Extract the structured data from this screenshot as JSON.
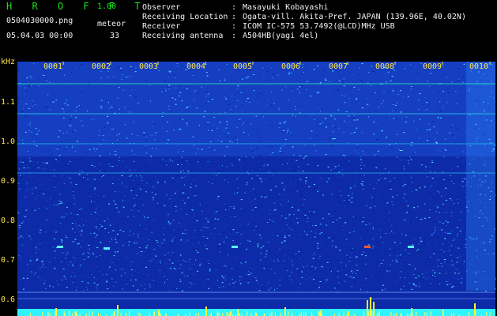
{
  "app": {
    "title_letters": "H R O F F T",
    "version": "1.00",
    "file_name": "0504030000.png",
    "datetime": "05.04.03 00:00",
    "meteor_label": "meteor",
    "meteor_count": "33"
  },
  "info": [
    {
      "label": "Observer",
      "sep": ":",
      "value": "Masayuki Kobayashi"
    },
    {
      "label": "Receiving Location",
      "sep": ":",
      "value": "Ogata-vill. Akita-Pref. JAPAN (139.96E, 40.02N)"
    },
    {
      "label": "Receiver",
      "sep": ":",
      "value": "ICOM IC-575 53.7492(@LCD)MHz USB"
    },
    {
      "label": "Receiving antenna",
      "sep": ":",
      "value": "A504HB(yagi 4el)"
    }
  ],
  "axis": {
    "unit": "kHz",
    "ticks": [
      "1.1",
      "1.0",
      "0.9",
      "0.8",
      "0.7",
      "0.6"
    ]
  },
  "frames": [
    "0001",
    "0002",
    "0003",
    "0004",
    "0005",
    "0006",
    "0007",
    "0008",
    "0009",
    "0010"
  ],
  "colors": {
    "background": "#000000",
    "label_yellow": "#ffe34a",
    "title_green": "#19e619",
    "spectrogram_base": "#0a1e9c",
    "meteor_bars": "#ffff33",
    "noise_floor": "#2ff3ff"
  }
}
